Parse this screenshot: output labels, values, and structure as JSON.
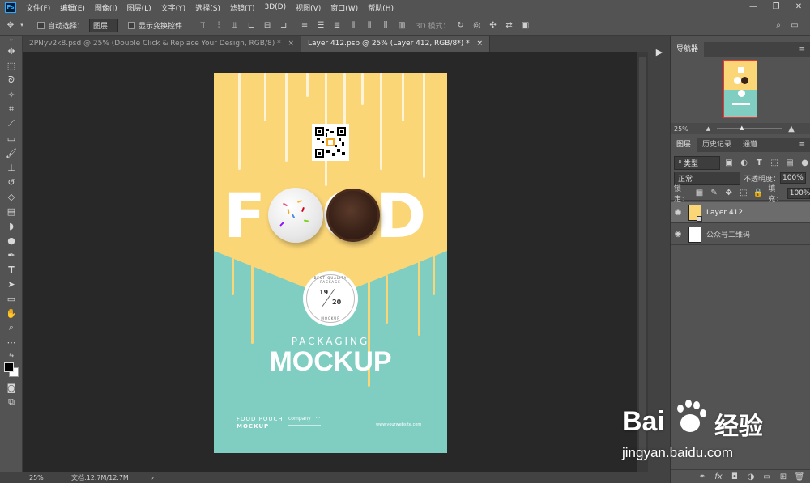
{
  "menubar": {
    "logo": "Ps",
    "items": [
      "文件(F)",
      "编辑(E)",
      "图像(I)",
      "图层(L)",
      "文字(Y)",
      "选择(S)",
      "滤镜(T)",
      "3D(D)",
      "视图(V)",
      "窗口(W)",
      "帮助(H)"
    ]
  },
  "options_bar": {
    "auto_select_label": "自动选择：",
    "auto_select_value": "图层",
    "show_transform_label": "显示变换控件",
    "mode_3d_label": "3D 模式："
  },
  "tabs": [
    {
      "label": "2PNyv2k8.psd @ 25% (Double Click & Replace Your Design, RGB/8) *",
      "close": "×"
    },
    {
      "label": "Layer 412.psb @ 25% (Layer 412, RGB/8*) *",
      "close": "×"
    }
  ],
  "poster": {
    "food": "FOOD",
    "badge_top": "BEST QUALITY PACKAGE",
    "badge_bottom": "MOCKUP",
    "badge_num1": "19",
    "badge_num2": "20",
    "packaging": "PACKAGING",
    "mockup": "MOCKUP",
    "footer_left_1": "FOOD POUCH",
    "footer_left_2": "MOCKUP",
    "footer_mid": "company · ···",
    "footer_right": "www.yourwebsite.com"
  },
  "navigator": {
    "title": "导航器",
    "zoom": "25%"
  },
  "layers_panel": {
    "tabs": [
      "图层",
      "历史记录",
      "通道"
    ],
    "filter_kind": "类型",
    "blend_mode": "正常",
    "opacity_label": "不透明度：",
    "opacity_value": "100%",
    "lock_label": "锁定：",
    "fill_label": "填充：",
    "fill_value": "100%",
    "layers": [
      {
        "name": "Layer 412",
        "visible": true,
        "selected": true
      },
      {
        "name": "公众号二维码",
        "visible": true,
        "selected": false
      }
    ]
  },
  "status": {
    "zoom": "25%",
    "doc_info": "文档:12.7M/12.7M",
    "arrow": "›"
  },
  "watermark": {
    "brand": "Bai",
    "brand2": "经验",
    "url": "jingyan.baidu.com"
  },
  "colors": {
    "ui_dark": "#535353",
    "poster_yellow": "#fbd677",
    "poster_teal": "#7fcec1"
  }
}
